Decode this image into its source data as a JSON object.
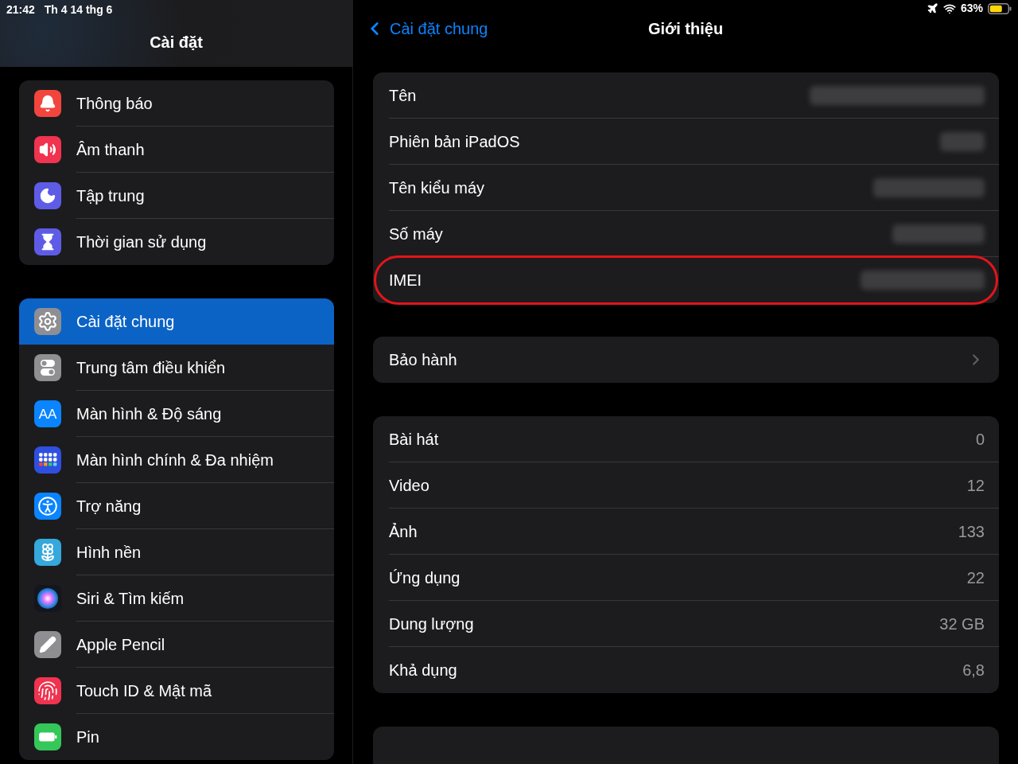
{
  "status_bar": {
    "time": "21:42",
    "date": "Th 4 14 thg 6",
    "battery": "63%"
  },
  "sidebar": {
    "title": "Cài đặt",
    "groups": [
      {
        "items": [
          {
            "label": "Thông báo",
            "selected": false
          },
          {
            "label": "Âm thanh",
            "selected": false
          },
          {
            "label": "Tập trung",
            "selected": false
          },
          {
            "label": "Thời gian sử dụng",
            "selected": false
          }
        ]
      },
      {
        "items": [
          {
            "label": "Cài đặt chung",
            "selected": true
          },
          {
            "label": "Trung tâm điều khiển",
            "selected": false
          },
          {
            "label": "Màn hình & Độ sáng",
            "selected": false,
            "icon_glyph": "AA"
          },
          {
            "label": "Màn hình chính & Đa nhiệm",
            "selected": false
          },
          {
            "label": "Trợ năng",
            "selected": false
          },
          {
            "label": "Hình nền",
            "selected": false
          },
          {
            "label": "Siri & Tìm kiếm",
            "selected": false
          },
          {
            "label": "Apple Pencil",
            "selected": false
          },
          {
            "label": "Touch ID & Mật mã",
            "selected": false
          },
          {
            "label": "Pin",
            "selected": false
          }
        ]
      }
    ]
  },
  "detail": {
    "back": "Cài đặt chung",
    "title": "Giới thiệu",
    "groups": [
      {
        "rows": [
          {
            "kind": "redacted",
            "label": "Tên",
            "highlighted": false
          },
          {
            "kind": "redacted",
            "label": "Phiên bản iPadOS",
            "highlighted": false
          },
          {
            "kind": "redacted",
            "label": "Tên kiểu máy",
            "highlighted": false
          },
          {
            "kind": "redacted",
            "label": "Số máy",
            "highlighted": false
          },
          {
            "kind": "redacted",
            "label": "IMEI",
            "highlighted": true
          }
        ]
      },
      {
        "rows": [
          {
            "kind": "disclosure",
            "label": "Bảo hành"
          }
        ]
      },
      {
        "rows": [
          {
            "kind": "value",
            "label": "Bài hát",
            "value": "0"
          },
          {
            "kind": "value",
            "label": "Video",
            "value": "12"
          },
          {
            "kind": "value",
            "label": "Ảnh",
            "value": "133"
          },
          {
            "kind": "value",
            "label": "Ứng dụng",
            "value": "22"
          },
          {
            "kind": "value",
            "label": "Dung lượng",
            "value": "32 GB"
          },
          {
            "kind": "value",
            "label": "Khả dụng",
            "value": "6,8"
          }
        ]
      }
    ]
  }
}
